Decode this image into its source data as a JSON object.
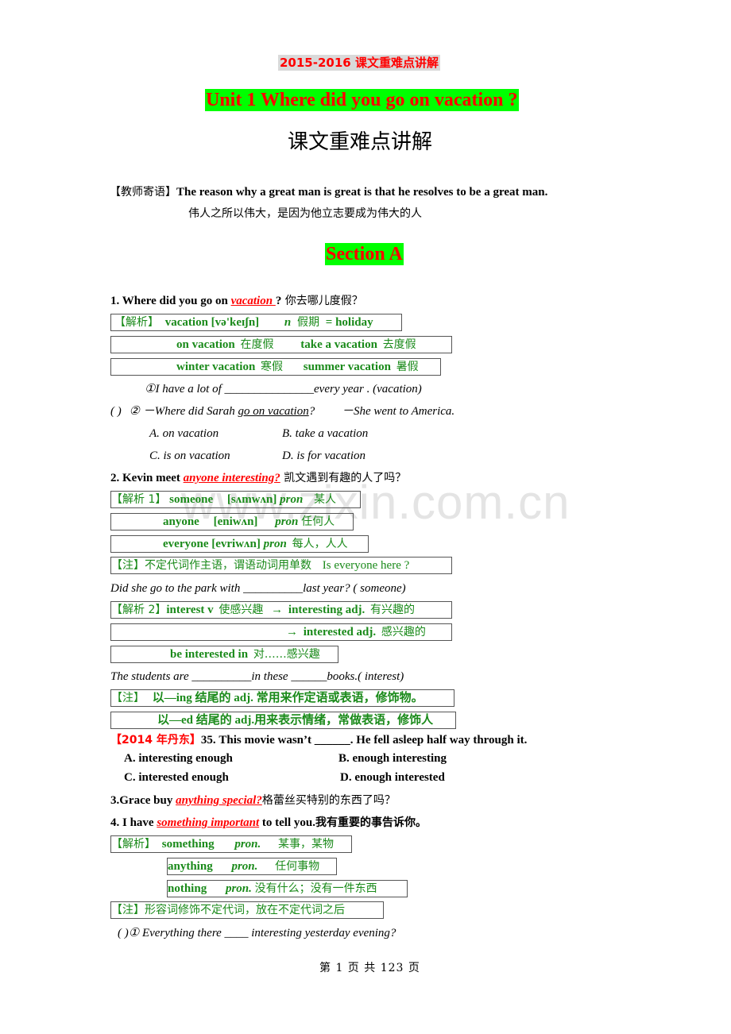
{
  "watermark": "www.zixin.com.cn",
  "header": {
    "top_title": "2015-2016 课文重难点讲解",
    "unit_title": "Unit 1 Where did you go on vacation ?",
    "main_title": "课文重难点讲解"
  },
  "motto": {
    "label": "【教师寄语】",
    "en": "The reason why a great man is great is that he resolves to be a great man.",
    "cn": "伟人之所以伟大，是因为他立志要成为伟大的人"
  },
  "section_title": "Section A",
  "item1": {
    "prefix": "1. Where did you go on ",
    "keyword": "vacation ",
    "suffix": "?",
    "cn": " 你去哪儿度假？",
    "box1": {
      "label": "【解析】",
      "word": "vacation [və'keɪʃn]",
      "pos": "n",
      "meaning": "假期",
      "eq": "= holiday"
    },
    "box2": {
      "a": "on vacation",
      "a_cn": "在度假",
      "b": "take a vacation",
      "b_cn": "去度假"
    },
    "box3": {
      "a": "winter vacation",
      "a_cn": "寒假",
      "b": "summer vacation",
      "b_cn": "暑假"
    },
    "ex1": "①I have a lot of _______________every year . (vacation)",
    "ex2_paren": "(      )",
    "ex2_q_pre": "② －Where did Sarah ",
    "ex2_q_ul": "go on vacation",
    "ex2_q_post": "?",
    "ex2_a": "－She went to America.",
    "options": [
      "A. on vacation",
      "B. take a vacation",
      "C. is on vacation",
      "D. is for vacation"
    ]
  },
  "item2": {
    "prefix": "2. Kevin meet ",
    "keyword": "anyone interesting?",
    "cn": " 凯文遇到有趣的人了吗？",
    "box1": {
      "label": "【解析 1】",
      "word": "someone",
      "ipa": "[sʌmwʌn]",
      "pos": "pron",
      "meaning": "某人"
    },
    "box2": {
      "word": "anyone",
      "ipa": "[eniwʌn]",
      "pos": "pron",
      "meaning": "任何人"
    },
    "box3": {
      "word": "everyone",
      "ipa": "[evriwʌn]",
      "pos": "pron",
      "meaning": "每人，人人"
    },
    "note1": {
      "label": "【注】",
      "cn": "不定代词作主语，谓语动词用单数",
      "en": "Is everyone here ?"
    },
    "ex1": "Did she go to the park with __________last year? ( someone)",
    "box4": {
      "label": "【解析 2】",
      "a": "interest v",
      "a_cn": "使感兴趣",
      "arrow": "→",
      "b": "interesting adj.",
      "b_cn": "有兴趣的"
    },
    "box5": {
      "arrow": "→",
      "b": "interested    adj.",
      "b_cn": "感兴趣的"
    },
    "box6": {
      "a": "be interested in",
      "a_cn": "对……感兴趣"
    },
    "ex2": "The students are __________in these ______books.( interest)",
    "note2": {
      "label": "【注】",
      "a": "以—ing 结尾的 adj. 常用来作定语或表语，修饰物。"
    },
    "note3": {
      "a": "以—ed 结尾的 adj.用来表示情绪，常做表语，修饰人"
    },
    "exam": {
      "tag": "【2014 年丹东】",
      "q": "35. This movie wasn’t ______. He fell asleep half way through it."
    },
    "options": [
      "A. interesting enough",
      "B. enough interesting",
      "C. interested enough",
      "D. enough interested"
    ]
  },
  "item3": {
    "prefix": "3.Grace buy ",
    "keyword": "anything special?",
    "cn": "格蕾丝买特别的东西了吗？"
  },
  "item4": {
    "prefix": "4. I have ",
    "keyword": "something important",
    "suffix": " to tell you.",
    "cn": "我有重要的事告诉你。",
    "box1": {
      "label": "【解析】",
      "word": "something",
      "pos": "pron.",
      "meaning": "某事，某物"
    },
    "box2": {
      "word": "anything",
      "pos": "pron.",
      "meaning": "任何事物"
    },
    "box3": {
      "word": "nothing",
      "pos": "pron.",
      "meaning": "没有什么；没有一件东西"
    },
    "note": {
      "label": "【注】",
      "cn": "形容词修饰不定代词，放在不定代词之后"
    },
    "ex1_paren": "(        )",
    "ex1": "① Everything there ____ interesting yesterday evening?"
  },
  "footer": "第 1 页 共 123 页"
}
